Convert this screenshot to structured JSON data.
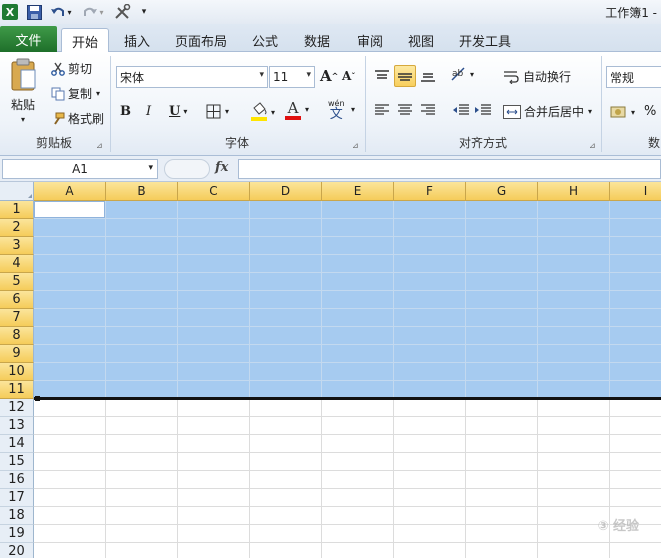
{
  "window": {
    "title": "工作簿1 -"
  },
  "quick_access": {
    "app_icon": "excel-icon",
    "items": [
      "save-icon",
      "undo-icon",
      "redo-icon",
      "customize-icon"
    ]
  },
  "tabs": {
    "file": "文件",
    "items": [
      "开始",
      "插入",
      "页面布局",
      "公式",
      "数据",
      "审阅",
      "视图",
      "开发工具"
    ],
    "active": "开始"
  },
  "ribbon": {
    "clipboard": {
      "paste": "粘贴",
      "cut": "剪切",
      "copy": "复制",
      "format_painter": "格式刷",
      "label": "剪贴板"
    },
    "font": {
      "name": "宋体",
      "size": "11",
      "bold": "B",
      "italic": "I",
      "underline": "U",
      "grow": "A",
      "shrink": "A",
      "font_color_letter": "A",
      "wen": "wén",
      "wen_char": "文",
      "label": "字体"
    },
    "alignment": {
      "wrap": "自动换行",
      "merge": "合并后居中",
      "label": "对齐方式"
    },
    "number": {
      "format": "常规",
      "percent": "%",
      "label": "数"
    }
  },
  "formula_bar": {
    "name_box": "A1",
    "fx": "fx",
    "value": ""
  },
  "grid": {
    "columns": [
      "A",
      "B",
      "C",
      "D",
      "E",
      "F",
      "G",
      "H",
      "I"
    ],
    "rows": [
      "1",
      "2",
      "3",
      "4",
      "5",
      "6",
      "7",
      "8",
      "9",
      "10",
      "11",
      "12",
      "13",
      "14",
      "15",
      "16",
      "17",
      "18",
      "19",
      "20"
    ],
    "selected_rows": "1-11",
    "active_cell": "A1"
  },
  "watermark": "③ 经验"
}
